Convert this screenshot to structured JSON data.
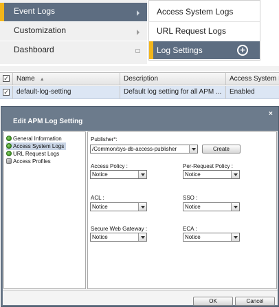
{
  "nav_menu": {
    "items": [
      {
        "label": "Event Logs",
        "active": true
      },
      {
        "label": "Customization",
        "active": false
      },
      {
        "label": "Dashboard",
        "active": false
      }
    ]
  },
  "sub_menu": {
    "items": [
      {
        "label": "Access System Logs",
        "active": false
      },
      {
        "label": "URL Request Logs",
        "active": false
      },
      {
        "label": "Log Settings",
        "active": true
      }
    ],
    "add_symbol": "+"
  },
  "table": {
    "columns": [
      "Name",
      "Description",
      "Access System L"
    ],
    "sort_indicator": "▲",
    "rows": [
      {
        "checked": true,
        "name": "default-log-setting",
        "description": "Default log setting for all APM ...",
        "access_system": "Enabled"
      }
    ]
  },
  "dialog": {
    "title": "Edit APM Log Setting",
    "close_symbol": "×",
    "tree": [
      {
        "label": "General Information",
        "icon": "gear-icon",
        "selected": false
      },
      {
        "label": "Access System Logs",
        "icon": "gear-icon",
        "selected": true
      },
      {
        "label": "URL Request Logs",
        "icon": "gear-icon",
        "selected": false
      },
      {
        "label": "Access Profiles",
        "icon": "key-icon",
        "selected": false
      }
    ],
    "publisher": {
      "label": "Publisher*:",
      "value": "/Common/sys-db-access-publisher",
      "create_label": "Create"
    },
    "fields": {
      "access_policy": {
        "label": "Access Policy :",
        "value": "Notice"
      },
      "per_request_policy": {
        "label": "Per-Request Policy :",
        "value": "Notice"
      },
      "acl": {
        "label": "ACL :",
        "value": "Notice"
      },
      "sso": {
        "label": "SSO :",
        "value": "Notice"
      },
      "secure_web_gateway": {
        "label": "Secure Web Gateway :",
        "value": "Notice"
      },
      "eca": {
        "label": "ECA :",
        "value": "Notice"
      }
    },
    "ok_label": "OK",
    "cancel_label": "Cancel"
  },
  "colors": {
    "active_bg": "#5d6d81",
    "accent": "#f2b51a",
    "dialog_frame": "#6c7b8c",
    "selected_row": "#dce6f4"
  }
}
